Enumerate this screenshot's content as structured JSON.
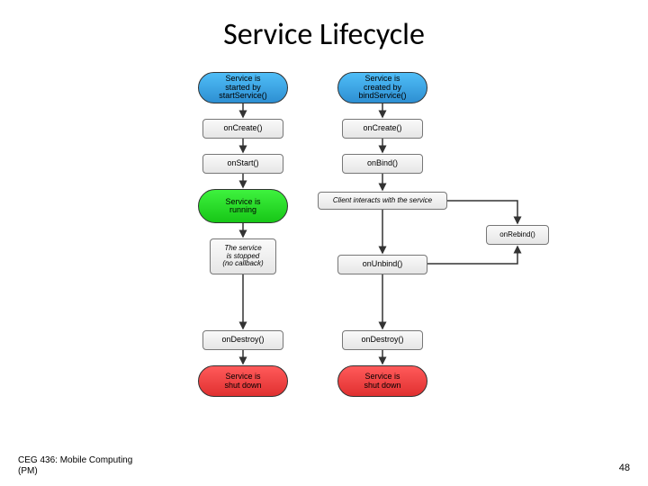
{
  "title": "Service Lifecycle",
  "footer": {
    "course": "CEG 436: Mobile Computing",
    "author": "(PM)",
    "page": "48"
  },
  "diagram": {
    "left": {
      "start": "Service is\nstarted by\nstartService()",
      "onCreate": "onCreate()",
      "onStart": "onStart()",
      "running": "Service is\nrunning",
      "stopped": "The service\nis stopped\n(no callback)",
      "onDestroy": "onDestroy()",
      "shutdown": "Service is\nshut down"
    },
    "right": {
      "start": "Service is\ncreated by\nbindService()",
      "onCreate": "onCreate()",
      "onBind": "onBind()",
      "client": "Client interacts with the service",
      "onUnbind": "onUnbind()",
      "onRebind": "onRebind()",
      "onDestroy": "onDestroy()",
      "shutdown": "Service is\nshut down"
    }
  }
}
